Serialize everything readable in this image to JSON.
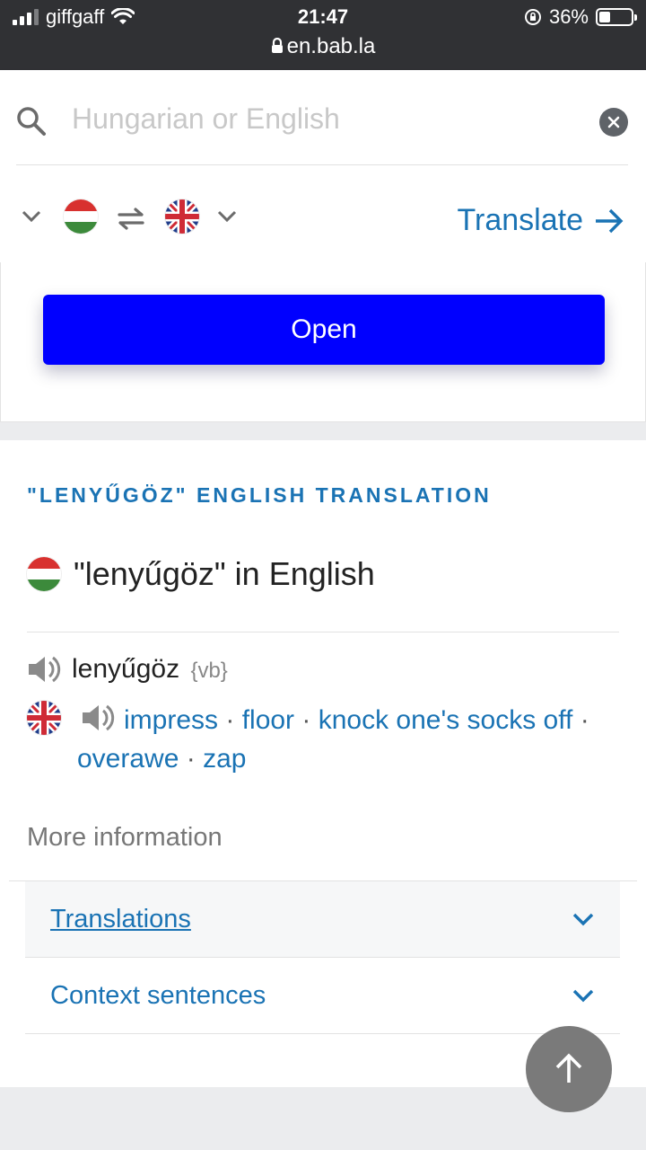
{
  "status_bar": {
    "carrier": "giffgaff",
    "time": "21:47",
    "url": "en.bab.la",
    "battery": "36%",
    "battery_level": 0.36
  },
  "search": {
    "placeholder": "Hungarian or English",
    "value": ""
  },
  "language_bar": {
    "source_flag": "hungary-flag",
    "target_flag": "uk-flag",
    "translate_label": "Translate"
  },
  "open_button": {
    "label": "Open"
  },
  "content": {
    "section_heading": "\"LENYŰGÖZ\" ENGLISH TRANSLATION",
    "entry_title": "\"lenyűgöz\" in English",
    "headword": "lenyűgöz",
    "part_of_speech": "{vb}",
    "translations": [
      "impress",
      "floor",
      "knock one's socks off",
      "overawe",
      "zap"
    ],
    "more_information": "More information",
    "accordion": [
      {
        "label": "Translations",
        "active": true
      },
      {
        "label": "Context sentences",
        "active": false
      }
    ]
  },
  "colors": {
    "link_blue": "#1a73b4",
    "open_button": "#0000ff",
    "status_bar": "#303134"
  }
}
